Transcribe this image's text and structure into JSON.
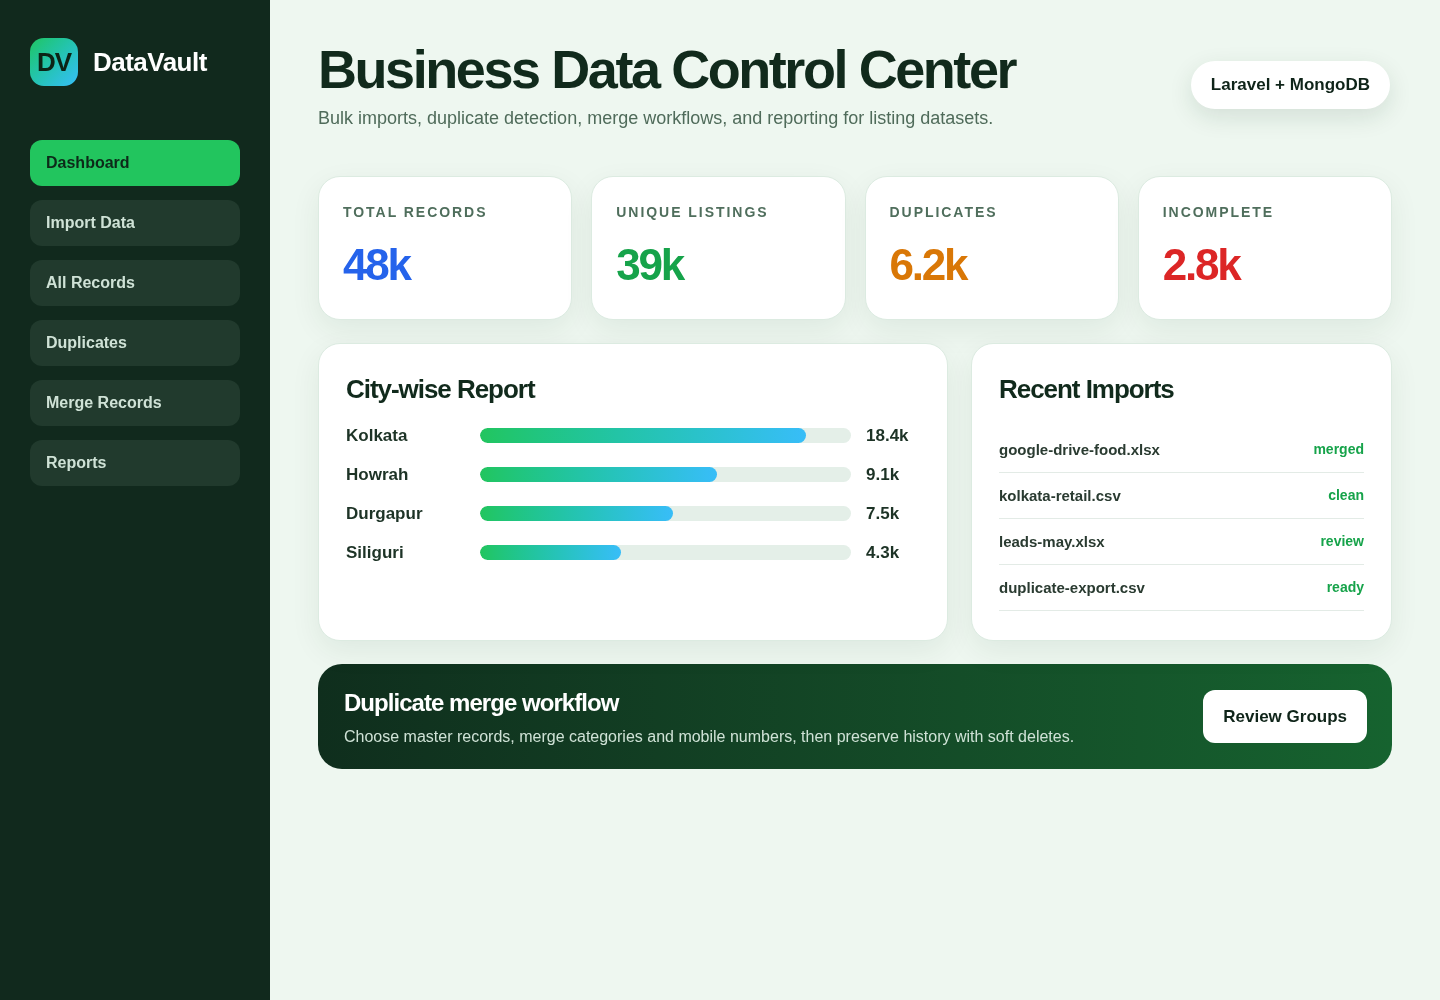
{
  "logo": {
    "mark": "DV",
    "name": "DataVault"
  },
  "sidebar": {
    "items": [
      {
        "label": "Dashboard",
        "selected": true
      },
      {
        "label": "Import Data",
        "selected": false
      },
      {
        "label": "All Records",
        "selected": false
      },
      {
        "label": "Duplicates",
        "selected": false
      },
      {
        "label": "Merge Records",
        "selected": false
      },
      {
        "label": "Reports",
        "selected": false
      }
    ]
  },
  "header": {
    "title": "Business Data Control Center",
    "subtitle": "Bulk imports, duplicate detection, merge workflows, and reporting for listing datasets.",
    "badge": "Laravel + MongoDB"
  },
  "stats": [
    {
      "label": "TOTAL RECORDS",
      "value": "48k",
      "color": "#2563eb"
    },
    {
      "label": "UNIQUE LISTINGS",
      "value": "39k",
      "color": "#16a34a"
    },
    {
      "label": "DUPLICATES",
      "value": "6.2k",
      "color": "#d97706"
    },
    {
      "label": "INCOMPLETE",
      "value": "2.8k",
      "color": "#dc2626"
    }
  ],
  "city_report": {
    "title": "City-wise Report",
    "rows": [
      {
        "city": "Kolkata",
        "level": 0.88,
        "reading": "18.4k"
      },
      {
        "city": "Howrah",
        "level": 0.64,
        "reading": "9.1k"
      },
      {
        "city": "Durgapur",
        "level": 0.52,
        "reading": "7.5k"
      },
      {
        "city": "Siliguri",
        "level": 0.38,
        "reading": "4.3k"
      }
    ]
  },
  "recent_imports": {
    "title": "Recent Imports",
    "rows": [
      {
        "file": "google-drive-food.xlsx",
        "status": "merged"
      },
      {
        "file": "kolkata-retail.csv",
        "status": "clean"
      },
      {
        "file": "leads-may.xlsx",
        "status": "review"
      },
      {
        "file": "duplicate-export.csv",
        "status": "ready"
      }
    ]
  },
  "workflow_banner": {
    "title": "Duplicate merge workflow",
    "description": "Choose master records, merge categories and mobile numbers, then preserve history with soft deletes.",
    "button": "Review Groups"
  }
}
